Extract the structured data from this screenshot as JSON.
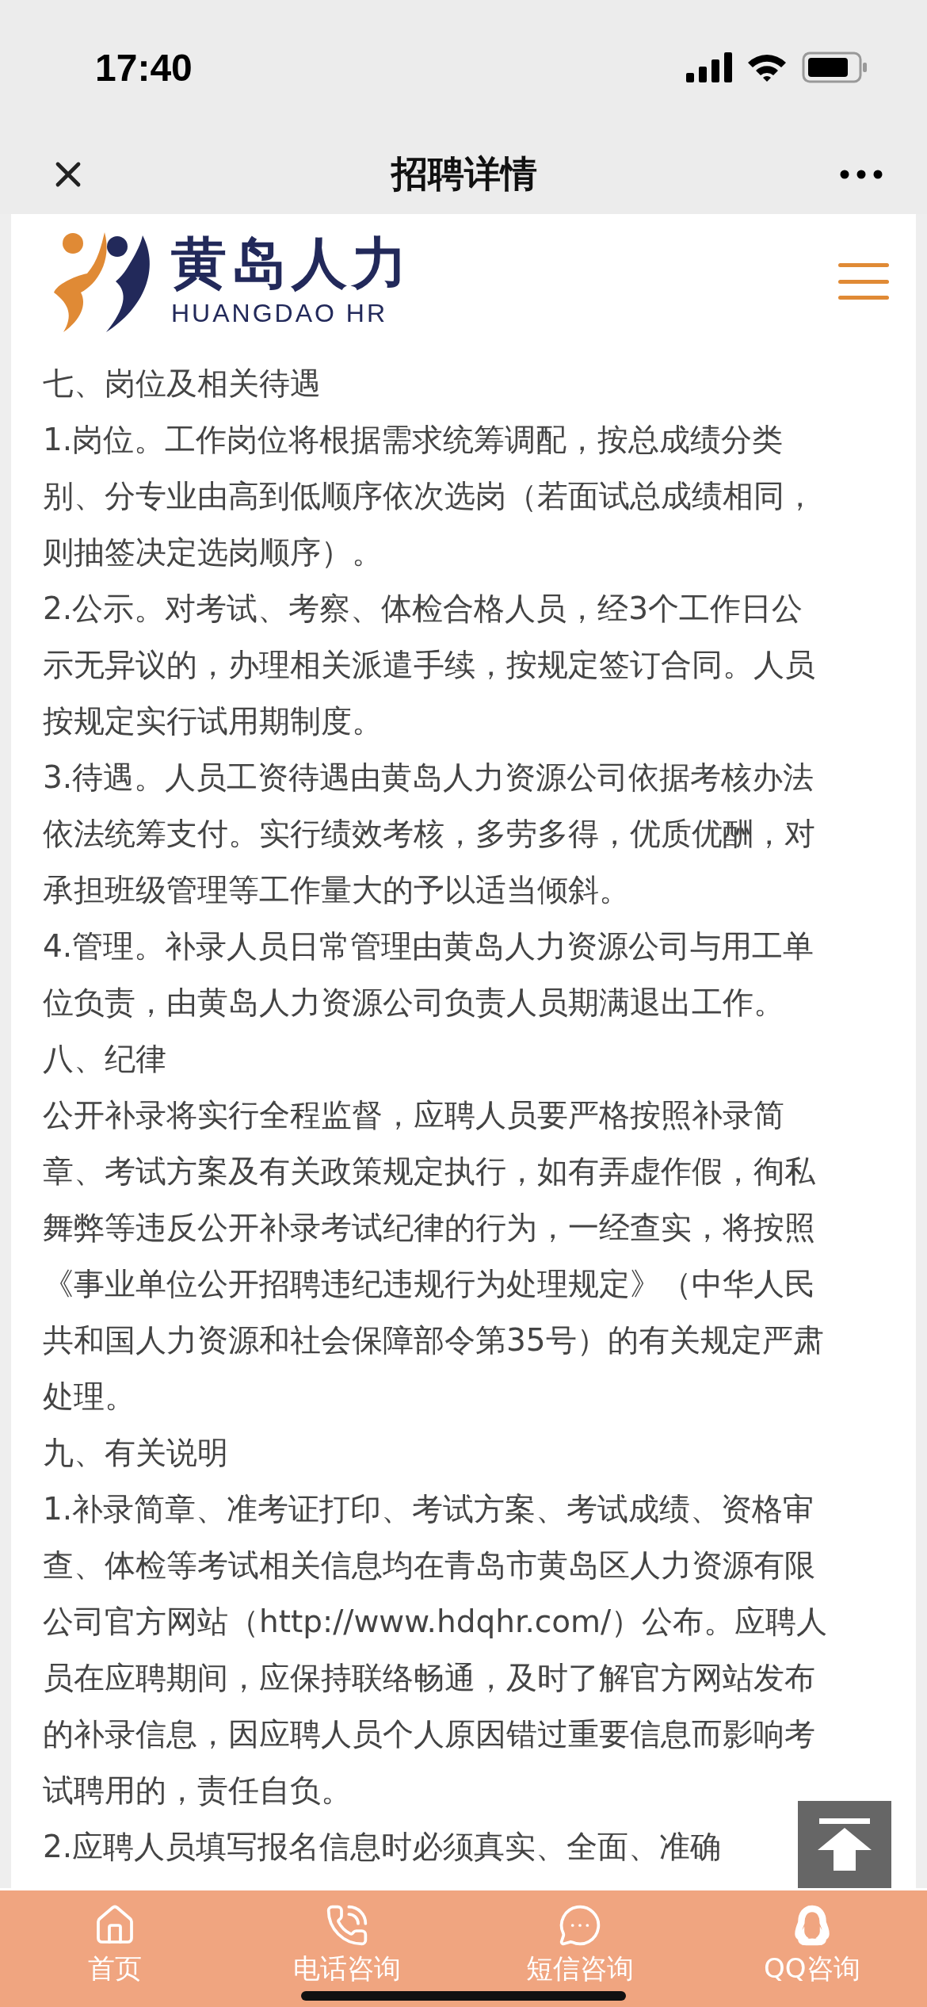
{
  "status_bar": {
    "time": "17:40"
  },
  "nav": {
    "title": "招聘详情"
  },
  "site_header": {
    "logo_cn": "黄岛人力",
    "logo_en": "HUANGDAO HR"
  },
  "article": {
    "paragraphs": [
      "七、岗位及相关待遇",
      "1.岗位。工作岗位将根据需求统筹调配，按总成绩分类别、分专业由高到低顺序依次选岗（若面试总成绩相同，则抽签决定选岗顺序）。",
      "2.公示。对考试、考察、体检合格人员，经3个工作日公示无异议的，办理相关派遣手续，按规定签订合同。人员按规定实行试用期制度。",
      "3.待遇。人员工资待遇由黄岛人力资源公司依据考核办法依法统筹支付。实行绩效考核，多劳多得，优质优酬，对承担班级管理等工作量大的予以适当倾斜。",
      "4.管理。补录人员日常管理由黄岛人力资源公司与用工单位负责，由黄岛人力资源公司负责人员期满退出工作。",
      "八、纪律",
      "公开补录将实行全程监督，应聘人员要严格按照补录简章、考试方案及有关政策规定执行，如有弄虚作假，徇私舞弊等违反公开补录考试纪律的行为，一经查实，将按照《事业单位公开招聘违纪违规行为处理规定》（中华人民共和国人力资源和社会保障部令第35号）的有关规定严肃处理。",
      "九、有关说明",
      "1.补录简章、准考证打印、考试方案、考试成绩、资格审查、体检等考试相关信息均在青岛市黄岛区人力资源有限公司官方网站（http://www.hdqhr.com/）公布。应聘人员在应聘期间，应保持联络畅通，及时了解官方网站发布的补录信息，因应聘人员个人原因错过重要信息而影响考试聘用的，责任自负。",
      "2.应聘人员填写报名信息时必须真实、全面、准确"
    ]
  },
  "tab_bar": [
    {
      "label": "首页"
    },
    {
      "label": "电话咨询"
    },
    {
      "label": "短信咨询"
    },
    {
      "label": "QQ咨询"
    }
  ]
}
